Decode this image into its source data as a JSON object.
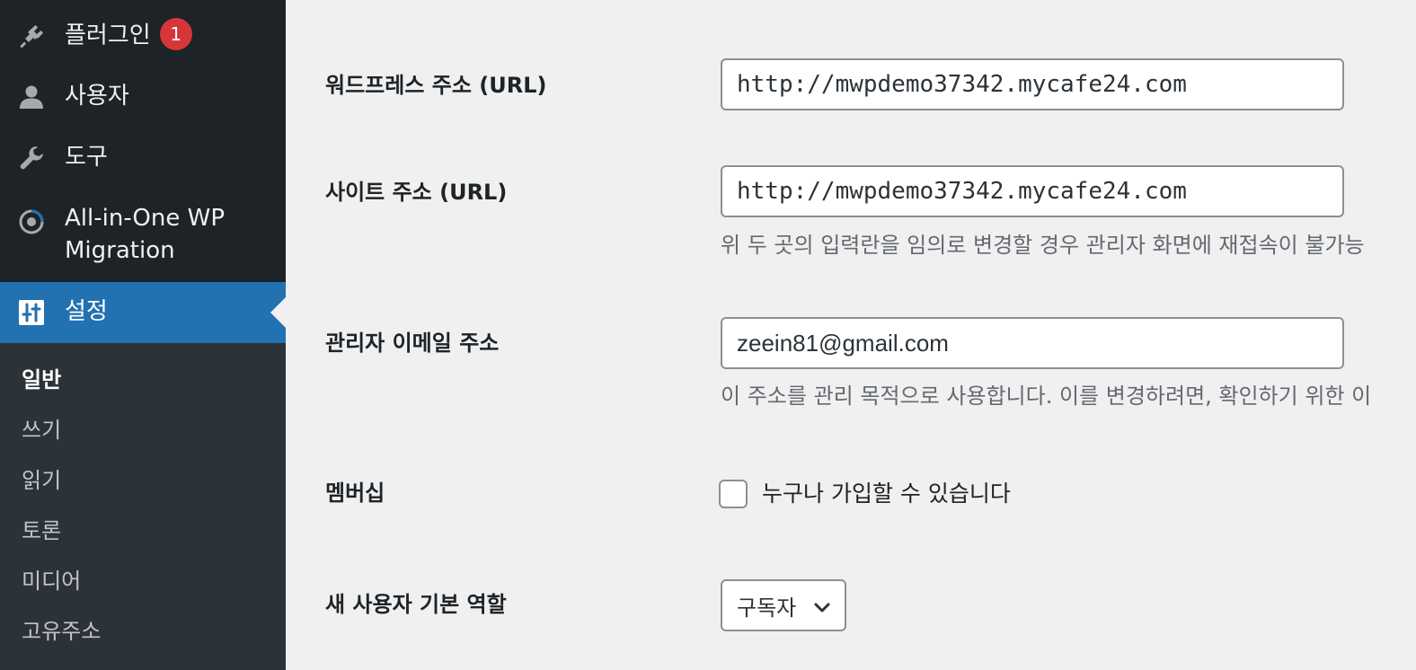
{
  "sidebar": {
    "menu": {
      "plugins": {
        "label": "플러그인",
        "badge": "1",
        "icon": "plugin-icon"
      },
      "users": {
        "label": "사용자",
        "icon": "user-icon"
      },
      "tools": {
        "label": "도구",
        "icon": "wrench-icon"
      },
      "migration": {
        "label_line1": "All-in-One WP",
        "label_line2": "Migration",
        "icon": "migration-icon"
      },
      "settings": {
        "label": "설정",
        "icon": "settings-icon",
        "active": true
      }
    },
    "submenu": [
      {
        "label": "일반",
        "current": true
      },
      {
        "label": "쓰기"
      },
      {
        "label": "읽기"
      },
      {
        "label": "토론"
      },
      {
        "label": "미디어"
      },
      {
        "label": "고유주소"
      }
    ]
  },
  "form": {
    "wp_address": {
      "label": "워드프레스 주소 (URL)",
      "value": "http://mwpdemo37342.mycafe24.com"
    },
    "site_address": {
      "label": "사이트 주소 (URL)",
      "value": "http://mwpdemo37342.mycafe24.com",
      "description": "위 두 곳의 입력란을 임의로 변경할 경우 관리자 화면에 재접속이 불가능"
    },
    "admin_email": {
      "label": "관리자 이메일 주소",
      "value": "zeein81@gmail.com",
      "description": "이 주소를 관리 목적으로 사용합니다. 이를 변경하려면, 확인하기 위한 이"
    },
    "membership": {
      "label": "멤버십",
      "checkbox_label": "누구나 가입할 수 있습니다",
      "checked": false
    },
    "default_role": {
      "label": "새 사용자 기본 역할",
      "selected": "구독자"
    }
  },
  "colors": {
    "sidebar_bg": "#1d2327",
    "submenu_bg": "#2c3338",
    "accent": "#2271b1",
    "badge": "#d63638",
    "page_bg": "#f0f0f1"
  }
}
